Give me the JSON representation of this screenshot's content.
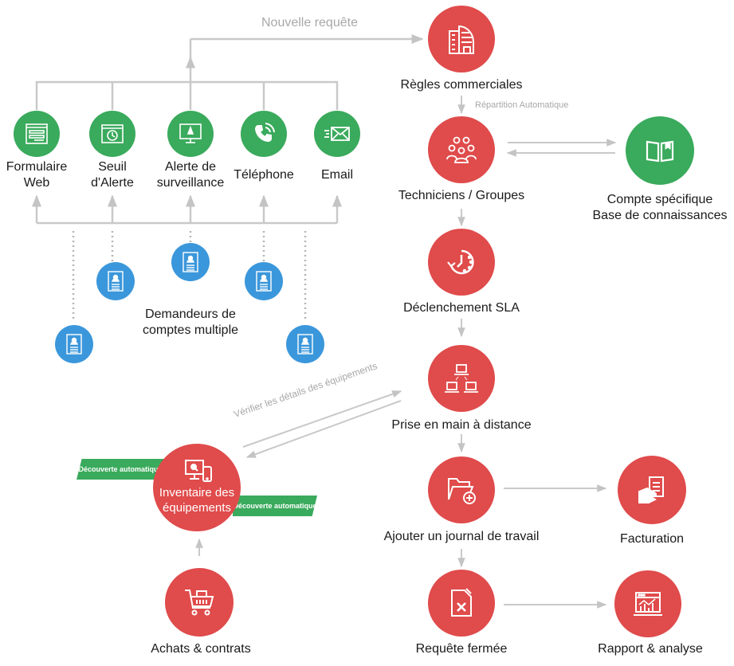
{
  "diagram": {
    "colors": {
      "source_green": "#3aaa5c",
      "process_red": "#e04b4b",
      "requester_blue": "#3b97db",
      "connector_gray": "#c4c4c4",
      "annotation_gray": "#a8a8a8"
    },
    "top_annotation": "Nouvelle requête",
    "auto_dispatch_annotation": "Répartition Automatique",
    "verify_annotation": "Vérifier les détails des équipements",
    "sources": [
      {
        "id": "web-form",
        "label_line1": "Formulaire",
        "label_line2": "Web",
        "icon": "web-form-icon"
      },
      {
        "id": "alert-threshold",
        "label_line1": "Seuil",
        "label_line2": "d'Alerte",
        "icon": "alert-threshold-icon"
      },
      {
        "id": "monitoring-alert",
        "label_line1": "Alerte de",
        "label_line2": "surveillance",
        "icon": "monitor-alert-icon"
      },
      {
        "id": "phone",
        "label_line1": "Téléphone",
        "label_line2": "",
        "icon": "phone-icon"
      },
      {
        "id": "email",
        "label_line1": "Email",
        "label_line2": "",
        "icon": "email-icon"
      }
    ],
    "requesters": {
      "label_line1": "Demandeurs de",
      "label_line2": "comptes multiple",
      "count": 5,
      "icon": "requester-card-icon"
    },
    "flow": [
      {
        "id": "business-rules",
        "label": "Règles commerciales",
        "icon": "building-icon"
      },
      {
        "id": "technicians",
        "label": "Techniciens / Groupes",
        "icon": "group-icon"
      },
      {
        "id": "sla",
        "label": "Déclenchement SLA",
        "icon": "clock-refresh-icon"
      },
      {
        "id": "remote",
        "label": "Prise en main à distance",
        "icon": "network-computers-icon"
      },
      {
        "id": "worklog",
        "label": "Ajouter un journal de travail",
        "icon": "folder-add-icon"
      },
      {
        "id": "closed",
        "label": "Requête fermée",
        "icon": "file-closed-icon"
      }
    ],
    "knowledge": {
      "label_line1": "Compte spécifique",
      "label_line2": "Base de connaissances",
      "icon": "book-icon"
    },
    "billing": {
      "label": "Facturation",
      "icon": "invoice-hand-icon"
    },
    "reports": {
      "label": "Rapport & analyse",
      "icon": "report-chart-icon"
    },
    "inventory": {
      "label_line1": "Inventaire des",
      "label_line2": "équipements",
      "icon": "devices-search-icon",
      "tag_left": "Découverte automatique",
      "tag_right": "Découverte automatique"
    },
    "purchases": {
      "label": "Achats & contrats",
      "icon": "shopping-cart-icon"
    }
  }
}
